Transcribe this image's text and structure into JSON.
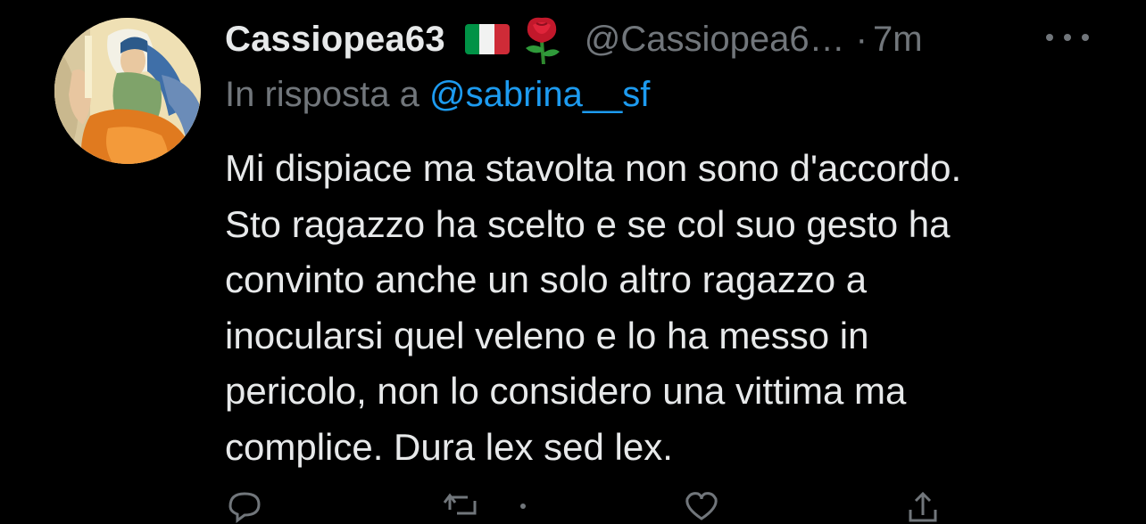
{
  "tweet": {
    "display_name": "Cassiopea63",
    "handle": "@Cassiopea6…",
    "separator": "·",
    "time": "7m",
    "reply_prefix": "In risposta a",
    "reply_to": "@sabrina__sf",
    "text_lines": [
      "Mi dispiace ma stavolta non sono d'accordo.",
      "Sto ragazzo ha scelto e se col suo gesto ha",
      "convinto anche un solo altro ragazzo a",
      "inocularsi quel veleno e lo ha messo in",
      "pericolo, non lo considero una vittima ma",
      "complice. Dura lex sed lex."
    ],
    "emojis": [
      "italy-flag-emoji",
      "rose-emoji"
    ]
  },
  "icons": {
    "more": "more-horizontal-icon",
    "reply": "reply-icon",
    "retweet": "retweet-icon",
    "like": "heart-icon",
    "share": "share-icon"
  },
  "colors": {
    "background": "#000000",
    "text_primary": "#e7e9ea",
    "text_secondary": "#71767b",
    "link": "#1d9bf0"
  }
}
